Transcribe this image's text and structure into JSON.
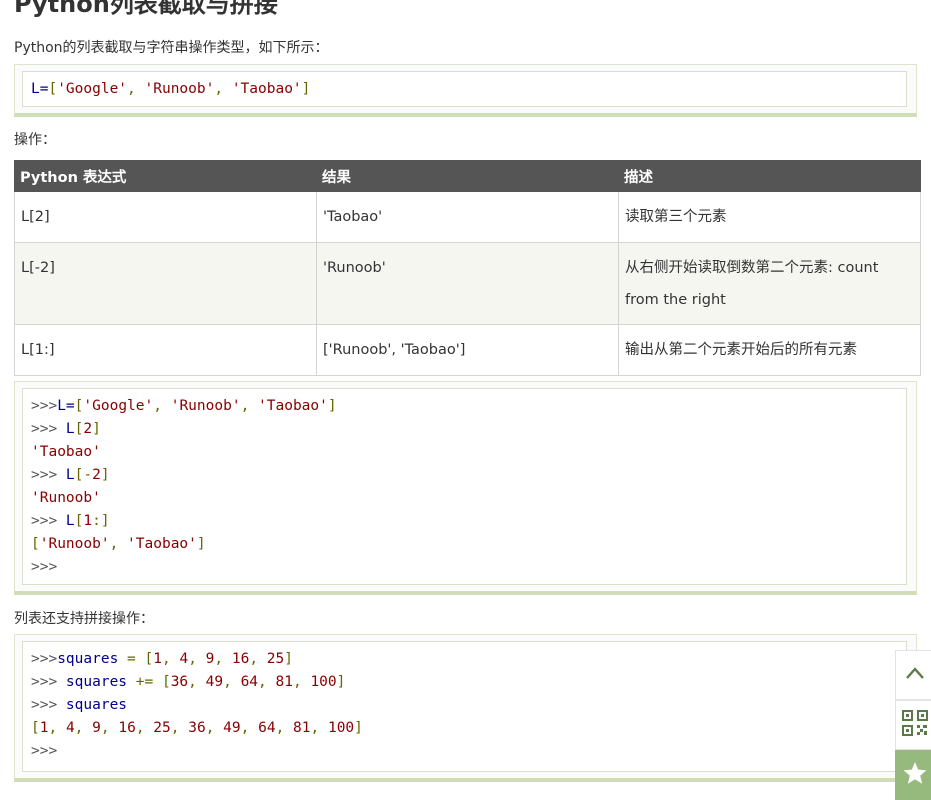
{
  "title": "Python列表截取与拼接",
  "intro": "Python的列表截取与字符串操作类型，如下所示：",
  "example_code": [
    [
      [
        "L=",
        "pln"
      ],
      [
        "[",
        "pun"
      ],
      [
        "'Google'",
        "str"
      ],
      [
        ", ",
        "pun"
      ],
      [
        "'Runoob'",
        "str"
      ],
      [
        ", ",
        "pun"
      ],
      [
        "'Taobao'",
        "str"
      ],
      [
        "]",
        "pun"
      ]
    ]
  ],
  "ops_label": "操作：",
  "table": {
    "headers": [
      "Python 表达式",
      "结果",
      "描述"
    ],
    "rows": [
      [
        "L[2]",
        "'Taobao'",
        "读取第三个元素"
      ],
      [
        "L[-2]",
        "'Runoob'",
        "从右侧开始读取倒数第二个元素: count from the right"
      ],
      [
        "L[1:]",
        "['Runoob', 'Taobao']",
        "输出从第二个元素开始后的所有元素"
      ]
    ]
  },
  "slice_code": [
    [
      [
        ">>>",
        "prompt"
      ],
      [
        "L=",
        "pln"
      ],
      [
        "[",
        "pun"
      ],
      [
        "'Google'",
        "str"
      ],
      [
        ", ",
        "pun"
      ],
      [
        "'Runoob'",
        "str"
      ],
      [
        ", ",
        "pun"
      ],
      [
        "'Taobao'",
        "str"
      ],
      [
        "]",
        "pun"
      ]
    ],
    [
      [
        ">>> ",
        "prompt"
      ],
      [
        "L",
        "pln"
      ],
      [
        "[",
        "pun"
      ],
      [
        "2",
        "num"
      ],
      [
        "]",
        "pun"
      ]
    ],
    [
      [
        "'Taobao'",
        "out"
      ]
    ],
    [
      [
        ">>> ",
        "prompt"
      ],
      [
        "L",
        "pln"
      ],
      [
        "[-",
        "pun"
      ],
      [
        "2",
        "num"
      ],
      [
        "]",
        "pun"
      ]
    ],
    [
      [
        "'Runoob'",
        "out"
      ]
    ],
    [
      [
        ">>> ",
        "prompt"
      ],
      [
        "L",
        "pln"
      ],
      [
        "[",
        "pun"
      ],
      [
        "1",
        "num"
      ],
      [
        ":]",
        "pun"
      ]
    ],
    [
      [
        "[",
        "pun"
      ],
      [
        "'Runoob'",
        "str"
      ],
      [
        ", ",
        "pun"
      ],
      [
        "'Taobao'",
        "str"
      ],
      [
        "]",
        "pun"
      ]
    ],
    [
      [
        ">>>",
        "prompt"
      ]
    ]
  ],
  "concat_label": "列表还支持拼接操作：",
  "concat_code": [
    [
      [
        ">>>",
        "prompt"
      ],
      [
        "squares ",
        "pln"
      ],
      [
        "= [",
        "pun"
      ],
      [
        "1",
        "num"
      ],
      [
        ", ",
        "pun"
      ],
      [
        "4",
        "num"
      ],
      [
        ", ",
        "pun"
      ],
      [
        "9",
        "num"
      ],
      [
        ", ",
        "pun"
      ],
      [
        "16",
        "num"
      ],
      [
        ", ",
        "pun"
      ],
      [
        "25",
        "num"
      ],
      [
        "]",
        "pun"
      ]
    ],
    [
      [
        ">>> ",
        "prompt"
      ],
      [
        "squares ",
        "pln"
      ],
      [
        "+= [",
        "pun"
      ],
      [
        "36",
        "num"
      ],
      [
        ", ",
        "pun"
      ],
      [
        "49",
        "num"
      ],
      [
        ", ",
        "pun"
      ],
      [
        "64",
        "num"
      ],
      [
        ", ",
        "pun"
      ],
      [
        "81",
        "num"
      ],
      [
        ", ",
        "pun"
      ],
      [
        "100",
        "num"
      ],
      [
        "]",
        "pun"
      ]
    ],
    [
      [
        ">>> ",
        "prompt"
      ],
      [
        "squares",
        "pln"
      ]
    ],
    [
      [
        "[",
        "pun"
      ],
      [
        "1",
        "num"
      ],
      [
        ", ",
        "pun"
      ],
      [
        "4",
        "num"
      ],
      [
        ", ",
        "pun"
      ],
      [
        "9",
        "num"
      ],
      [
        ", ",
        "pun"
      ],
      [
        "16",
        "num"
      ],
      [
        ", ",
        "pun"
      ],
      [
        "25",
        "num"
      ],
      [
        ", ",
        "pun"
      ],
      [
        "36",
        "num"
      ],
      [
        ", ",
        "pun"
      ],
      [
        "49",
        "num"
      ],
      [
        ", ",
        "pun"
      ],
      [
        "64",
        "num"
      ],
      [
        ", ",
        "pun"
      ],
      [
        "81",
        "num"
      ],
      [
        ", ",
        "pun"
      ],
      [
        "100",
        "num"
      ],
      [
        "]",
        "pun"
      ]
    ],
    [
      [
        ">>>",
        "prompt"
      ]
    ]
  ],
  "side_tools": [
    {
      "icon": "chevron-up-icon"
    },
    {
      "icon": "qr-code-icon"
    },
    {
      "icon": "star-icon"
    }
  ],
  "colors": {
    "code_string": "#880000",
    "code_punct": "#666600",
    "code_ident": "#000088",
    "table_header_bg": "#555555",
    "codebox_border": "#d0ddb7",
    "favorite_bg": "#96b97d"
  }
}
